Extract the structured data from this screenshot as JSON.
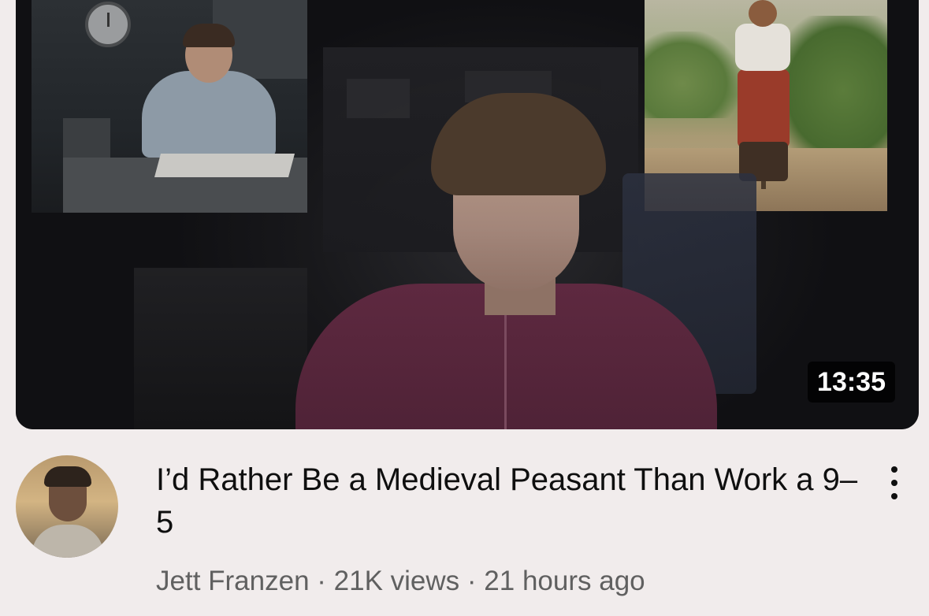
{
  "video": {
    "title": "I’d Rather Be a Medieval Peasant Than Work a 9–5",
    "duration": "13:35",
    "channel": "Jett Franzen",
    "separator": " · ",
    "views": "21K views",
    "uploaded": "21 hours ago"
  },
  "icons": {
    "menu": "more-vert-icon",
    "avatar": "channel-avatar"
  },
  "colors": {
    "background": "#f1ecec",
    "title_text": "#0f0f0f",
    "meta_text": "#606060",
    "duration_badge": "#000000"
  }
}
